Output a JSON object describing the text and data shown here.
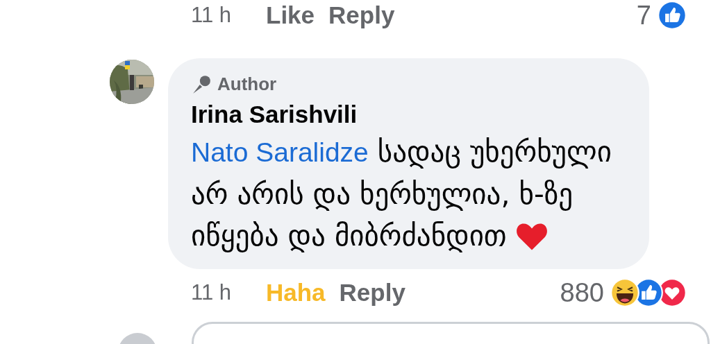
{
  "previous_comment": {
    "time": "11 h",
    "reaction_button": {
      "label": "Like",
      "active": false
    },
    "reply_label": "Reply",
    "reaction_count": "7",
    "reaction_icons": [
      {
        "kind": "like"
      }
    ]
  },
  "comment": {
    "badge": "Author",
    "author": "Irina Sarishvili",
    "mention": "Nato Saralidze",
    "text": "სადაც უხერხული არ არის და ხერხულია, ხ-ზე იწყება და მიბრძანდით",
    "emoji": {
      "kind": "heart"
    },
    "time": "11 h",
    "reaction_button": {
      "label": "Haha",
      "active": true
    },
    "reply_label": "Reply",
    "reaction_count": "880",
    "reaction_icons": [
      {
        "kind": "haha"
      },
      {
        "kind": "like"
      },
      {
        "kind": "love"
      }
    ]
  }
}
